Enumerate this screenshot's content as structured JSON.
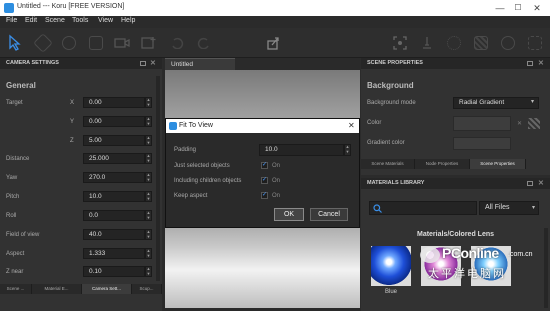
{
  "window": {
    "title": "Untitled --- Koru [FREE VERSION]",
    "min": "—",
    "max": "☐",
    "close": "✕"
  },
  "menu": [
    "File",
    "Edit",
    "Scene",
    "Tools",
    "View",
    "Help"
  ],
  "toolbar": {
    "icons": [
      "pointer-icon",
      "cube-icon",
      "sphere-icon",
      "cylinder-icon",
      "camera-icon",
      "add-image-icon",
      "undo-icon",
      "redo-icon",
      "export-icon",
      "fit-view-icon",
      "light-icon",
      "sun-icon",
      "checker-icon",
      "person-icon",
      "settings-icon"
    ]
  },
  "camera_panel": {
    "title": "CAMERA SETTINGS",
    "section": "General",
    "target": {
      "label": "Target",
      "x_label": "X",
      "y_label": "Y",
      "z_label": "Z",
      "x": "0.00",
      "y": "0.00",
      "z": "5.00"
    },
    "rows": [
      {
        "label": "Distance",
        "value": "25.000"
      },
      {
        "label": "Yaw",
        "value": "270.0"
      },
      {
        "label": "Pitch",
        "value": "10.0"
      },
      {
        "label": "Roll",
        "value": "0.0"
      },
      {
        "label": "Field of view",
        "value": "40.0"
      },
      {
        "label": "Aspect",
        "value": "1.333"
      },
      {
        "label": "Z near",
        "value": "0.10"
      }
    ],
    "tabs": [
      "Scene ...",
      "Material E...",
      "Camera Sett...",
      "Scup..."
    ],
    "active_tab": 2
  },
  "viewport": {
    "tab": "Untitled"
  },
  "dialog": {
    "title": "Fit To View",
    "padding_label": "Padding",
    "padding_value": "10.0",
    "options": [
      {
        "label": "Just selected objects",
        "checked": true,
        "state": "On"
      },
      {
        "label": "Including children objects",
        "checked": true,
        "state": "On"
      },
      {
        "label": "Keep aspect",
        "checked": true,
        "state": "On"
      }
    ],
    "ok": "OK",
    "cancel": "Cancel"
  },
  "scene_panel": {
    "title": "SCENE PROPERTIES",
    "section": "Background",
    "bg_mode_label": "Background mode",
    "bg_mode_value": "Radial Gradient",
    "color_label": "Color",
    "gradient_label": "Gradient color",
    "tabs": [
      "Scene Materials",
      "Node Properties",
      "Scene Properties"
    ],
    "active_tab": 2
  },
  "materials_panel": {
    "title": "MATERIALS LIBRARY",
    "search_placeholder": "",
    "filter_value": "All Files",
    "category": "Materials/Colored Lens",
    "items": [
      {
        "name": "Blue"
      }
    ]
  },
  "watermark": {
    "logo": "PConline",
    "suffix": ".com.cn",
    "chinese": "太平洋电脑网"
  },
  "colors": {
    "accent": "#3a8ee6",
    "dialog_title": "#ffffff",
    "panel": "#323232"
  }
}
